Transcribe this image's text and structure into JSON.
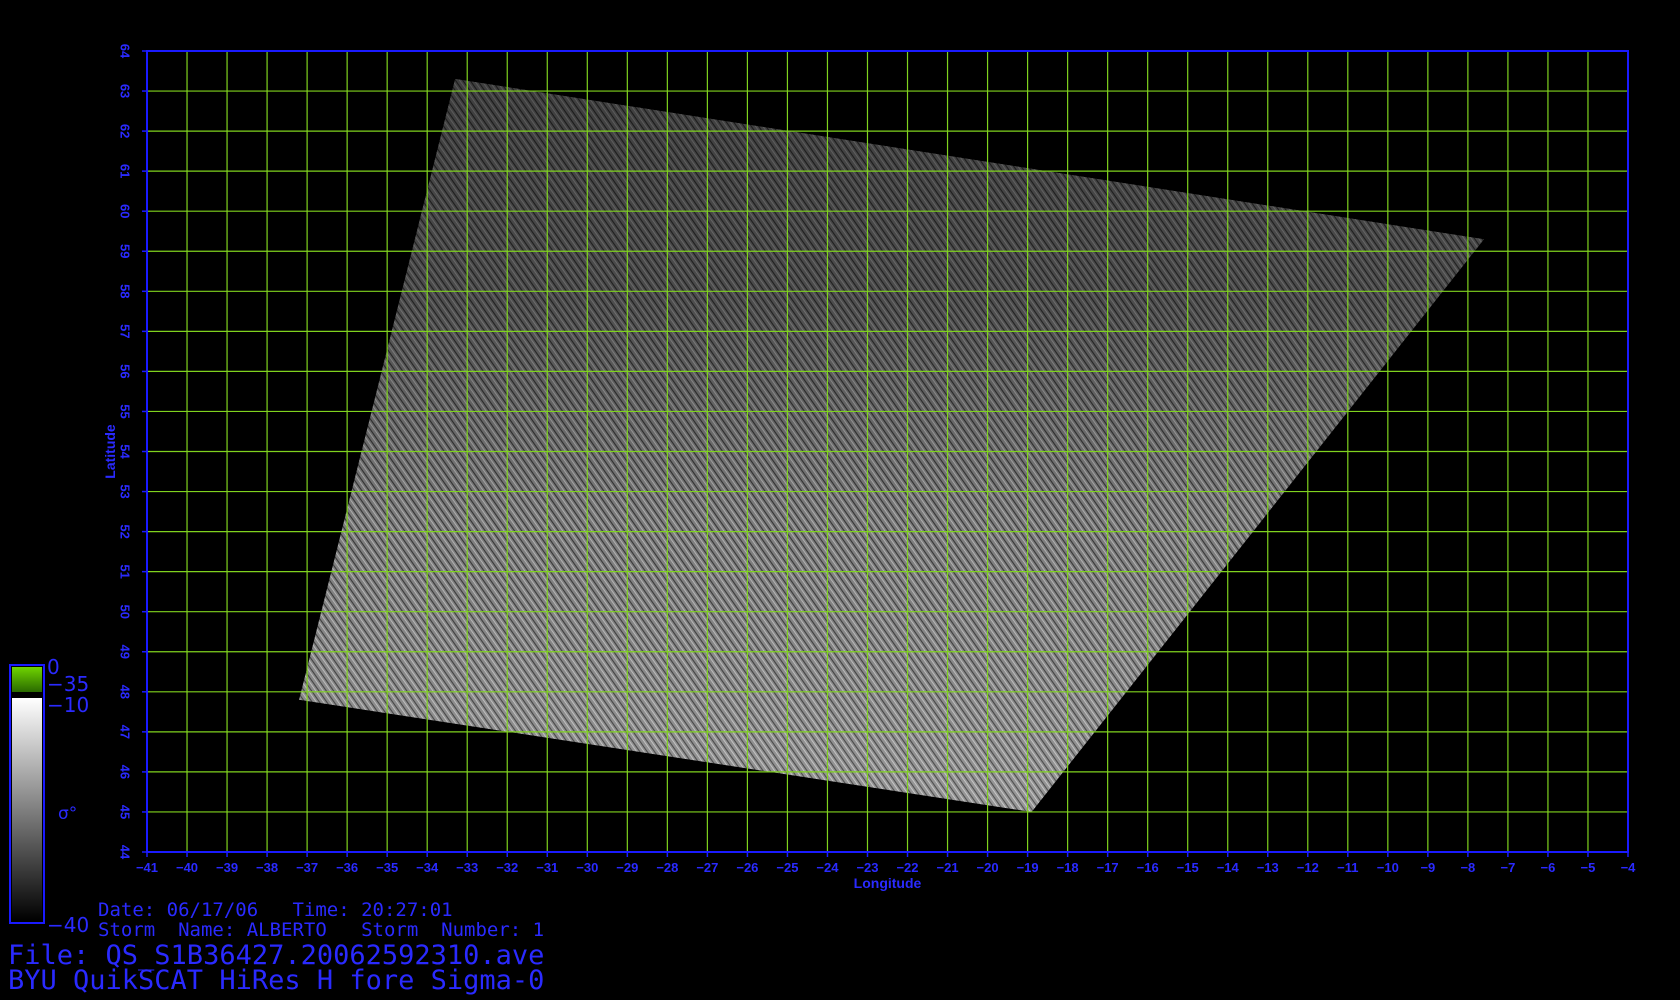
{
  "colors": {
    "background": "#000000",
    "axis": "#1a1aff",
    "text": "#2a2aff",
    "grid": "#7fd21e",
    "colorbar_top": "#66cc00"
  },
  "chart_data": {
    "type": "map",
    "xlabel": "Longitude",
    "ylabel": "Latitude",
    "xlim": [
      -41,
      -4
    ],
    "ylim": [
      44,
      64
    ],
    "x_ticks": [
      -41,
      -40,
      -39,
      -38,
      -37,
      -36,
      -35,
      -34,
      -33,
      -32,
      -31,
      -30,
      -29,
      -28,
      -27,
      -26,
      -25,
      -24,
      -23,
      -22,
      -21,
      -20,
      -19,
      -18,
      -17,
      -16,
      -15,
      -14,
      -13,
      -12,
      -11,
      -10,
      -9,
      -8,
      -7,
      -6,
      -5,
      -4
    ],
    "y_ticks": [
      44,
      45,
      46,
      47,
      48,
      49,
      50,
      51,
      52,
      53,
      54,
      55,
      56,
      57,
      58,
      59,
      60,
      61,
      62,
      63,
      64
    ],
    "grid": true,
    "swath_corners_lonlat": [
      [
        -33.3,
        63.3
      ],
      [
        -7.6,
        59.3
      ],
      [
        -18.9,
        45.0
      ],
      [
        -37.2,
        47.8
      ]
    ],
    "colorbar": {
      "label": "σ°",
      "ticks": [
        "0",
        "−35",
        "−10",
        "−40"
      ]
    }
  },
  "info": {
    "date_line": "Date: 06/17/06   Time: 20:27:01",
    "storm_line": "Storm  Name: ALBERTO   Storm  Number: 1",
    "file_line": "File: QS_S1B36427.20062592310.ave",
    "product_line": "BYU QuikSCAT HiRes H fore Sigma-0"
  }
}
